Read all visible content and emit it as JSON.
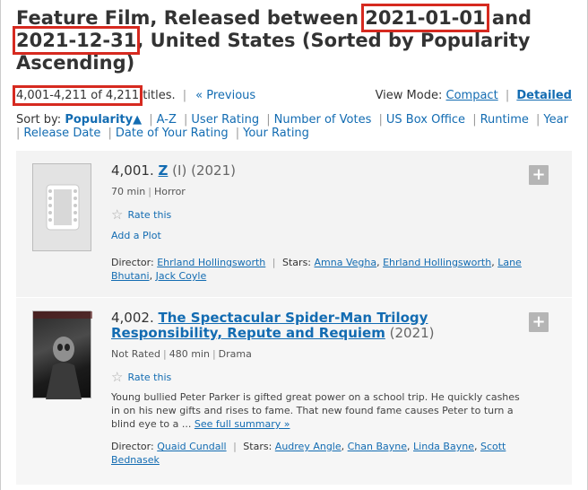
{
  "header": {
    "title_part1": "Feature Film, Released between ",
    "date_start": "2021-01-01",
    "title_part2": " and ",
    "date_end": "2021-12-31",
    "title_part3": ", United States (Sorted by Popularity Ascending)"
  },
  "results": {
    "count": "4,001-4,211 of 4,211",
    "suffix": " titles.",
    "previous_label": "« Previous"
  },
  "view_mode": {
    "label": "View Mode:",
    "compact": "Compact",
    "detailed": "Detailed"
  },
  "sort": {
    "label": "Sort by:",
    "options": [
      "Popularity▲",
      "A-Z",
      "User Rating",
      "Number of Votes",
      "US Box Office",
      "Runtime",
      "Year",
      "Release Date",
      "Date of Your Rating",
      "Your Rating"
    ]
  },
  "items": [
    {
      "index": "4,001.",
      "title": "Z",
      "qualifier": "(I)",
      "year": "(2021)",
      "runtime": "70 min",
      "genre": "Horror",
      "rate_label": "Rate this",
      "plot_label": "Add a Plot",
      "director_label": "Director:",
      "director": "Ehrland Hollingsworth",
      "stars_label": "Stars:",
      "stars": [
        "Amna Vegha",
        "Ehrland Hollingsworth",
        "Lane Bhutani",
        "Jack Coyle"
      ]
    },
    {
      "index": "4,002.",
      "title": "The Spectacular Spider-Man Trilogy Responsibility, Repute and Requiem",
      "year": "(2021)",
      "rating": "Not Rated",
      "runtime": "480 min",
      "genre": "Drama",
      "rate_label": "Rate this",
      "summary": "Young bullied Peter Parker is gifted great power on a school trip. He quickly cashes in on his new gifts and rises to fame. That new found fame causes Peter to turn a blind eye to a ...",
      "summary_link": "See full summary »",
      "director_label": "Director:",
      "director": "Quaid Cundall",
      "stars_label": "Stars:",
      "stars": [
        "Audrey Angle",
        "Chan Bayne",
        "Linda Bayne",
        "Scott Bednasek"
      ]
    }
  ],
  "add_button": "+",
  "colors": {
    "link": "#136cb2",
    "highlight": "#d62a20",
    "item_bg": "#f3f3f3"
  }
}
